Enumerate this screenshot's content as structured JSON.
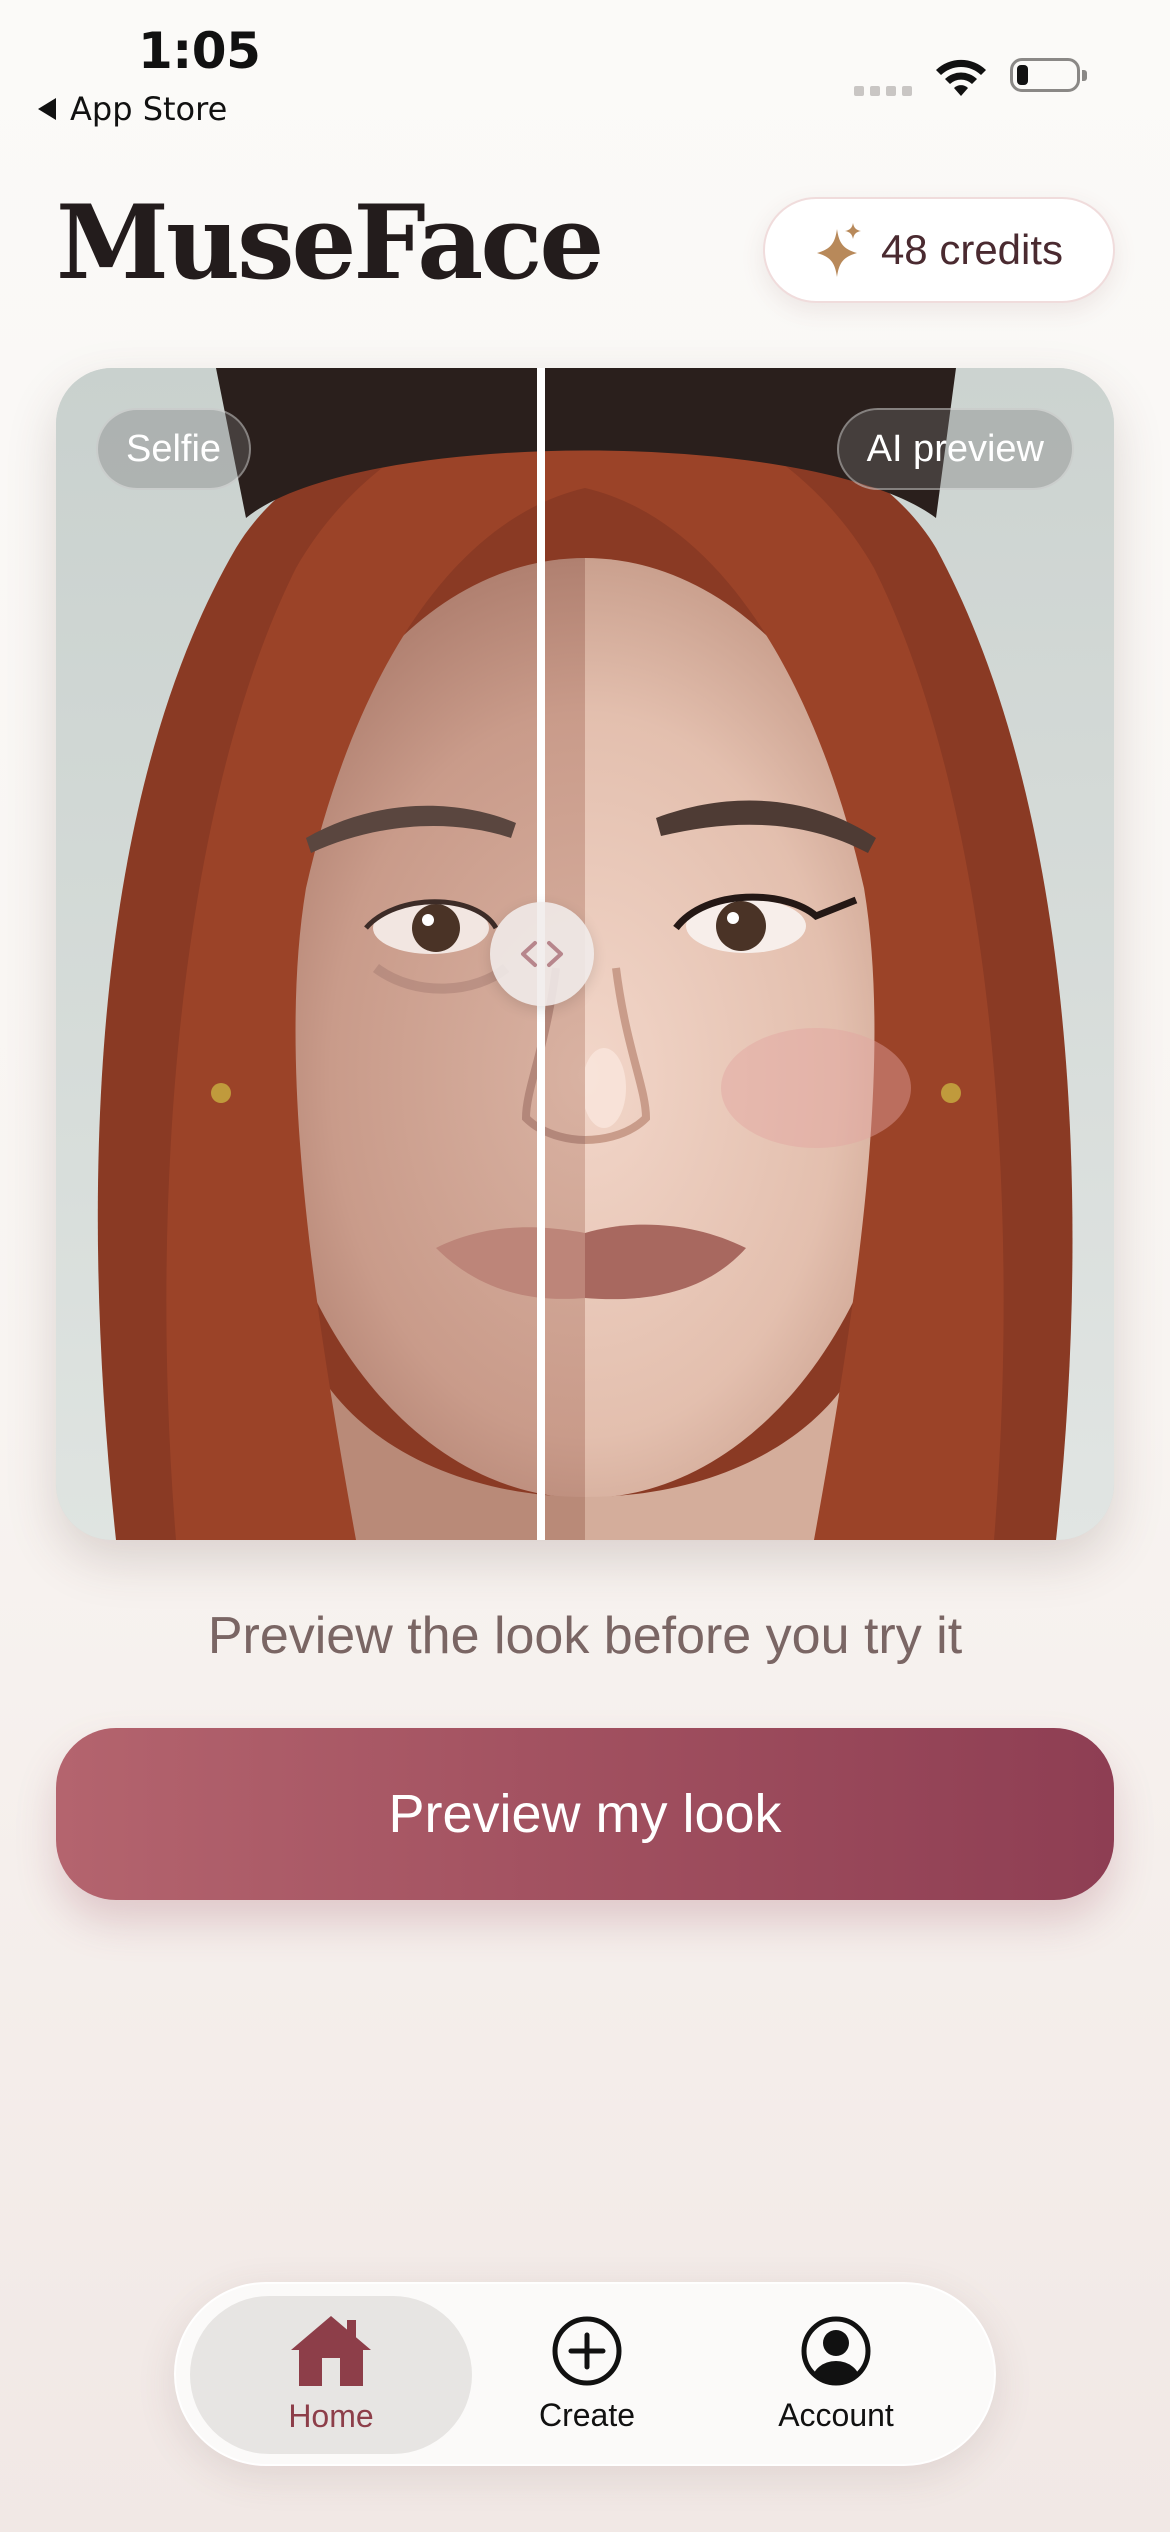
{
  "status_bar": {
    "time": "1:05",
    "back_label": "App Store"
  },
  "header": {
    "title": "MuseFace",
    "credits_label": "48 credits"
  },
  "compare": {
    "left_badge": "Selfie",
    "right_badge": "AI preview"
  },
  "tagline": "Preview the look before you try it",
  "cta_label": "Preview my look",
  "tabs": [
    {
      "label": "Home",
      "icon": "home-icon",
      "active": true
    },
    {
      "label": "Create",
      "icon": "plus-circle-icon",
      "active": false
    },
    {
      "label": "Account",
      "icon": "account-icon",
      "active": false
    }
  ],
  "colors": {
    "accent": "#9f4e5e",
    "active_tab": "#8d3e49",
    "sparkle": "#b8895a"
  }
}
